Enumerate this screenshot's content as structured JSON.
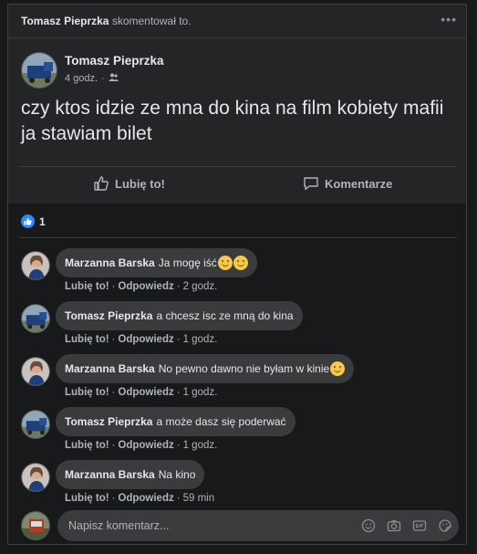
{
  "notice": {
    "name": "Tomasz Pieprzka",
    "text": "skomentował to."
  },
  "post": {
    "author": "Tomasz Pieprzka",
    "time": "4 godz.",
    "dot": "·",
    "text": "czy ktos idzie ze mna do kina na film kobiety mafii ja stawiam bilet"
  },
  "actions": {
    "like": "Lubię to!",
    "comment": "Komentarze"
  },
  "reactions": {
    "count": "1"
  },
  "comments": [
    {
      "name": "Marzanna Barska",
      "text": "Ja mogę iść",
      "like": "Lubię to!",
      "reply": "Odpowiedz",
      "time": "2 godz."
    },
    {
      "name": "Tomasz Pieprzka",
      "text": "a chcesz isc ze mną do kina",
      "like": "Lubię to!",
      "reply": "Odpowiedz",
      "time": "1 godz."
    },
    {
      "name": "Marzanna Barska",
      "text": "No pewno dawno nie byłam w kinie",
      "like": "Lubię to!",
      "reply": "Odpowiedz",
      "time": "1 godz."
    },
    {
      "name": "Tomasz Pieprzka",
      "text": "a może dasz się poderwać",
      "like": "Lubię to!",
      "reply": "Odpowiedz",
      "time": "1 godz."
    },
    {
      "name": "Marzanna Barska",
      "text": "Na kino",
      "like": "Lubię to!",
      "reply": "Odpowiedz",
      "time": "59 min"
    }
  ],
  "composer": {
    "placeholder": "Napisz komentarz..."
  },
  "colors": {
    "background": "#18191a",
    "card": "#242526",
    "bubble": "#3a3b3c",
    "accent": "#2d88ff",
    "text": "#e4e6eb",
    "muted": "#b0b3b8"
  }
}
